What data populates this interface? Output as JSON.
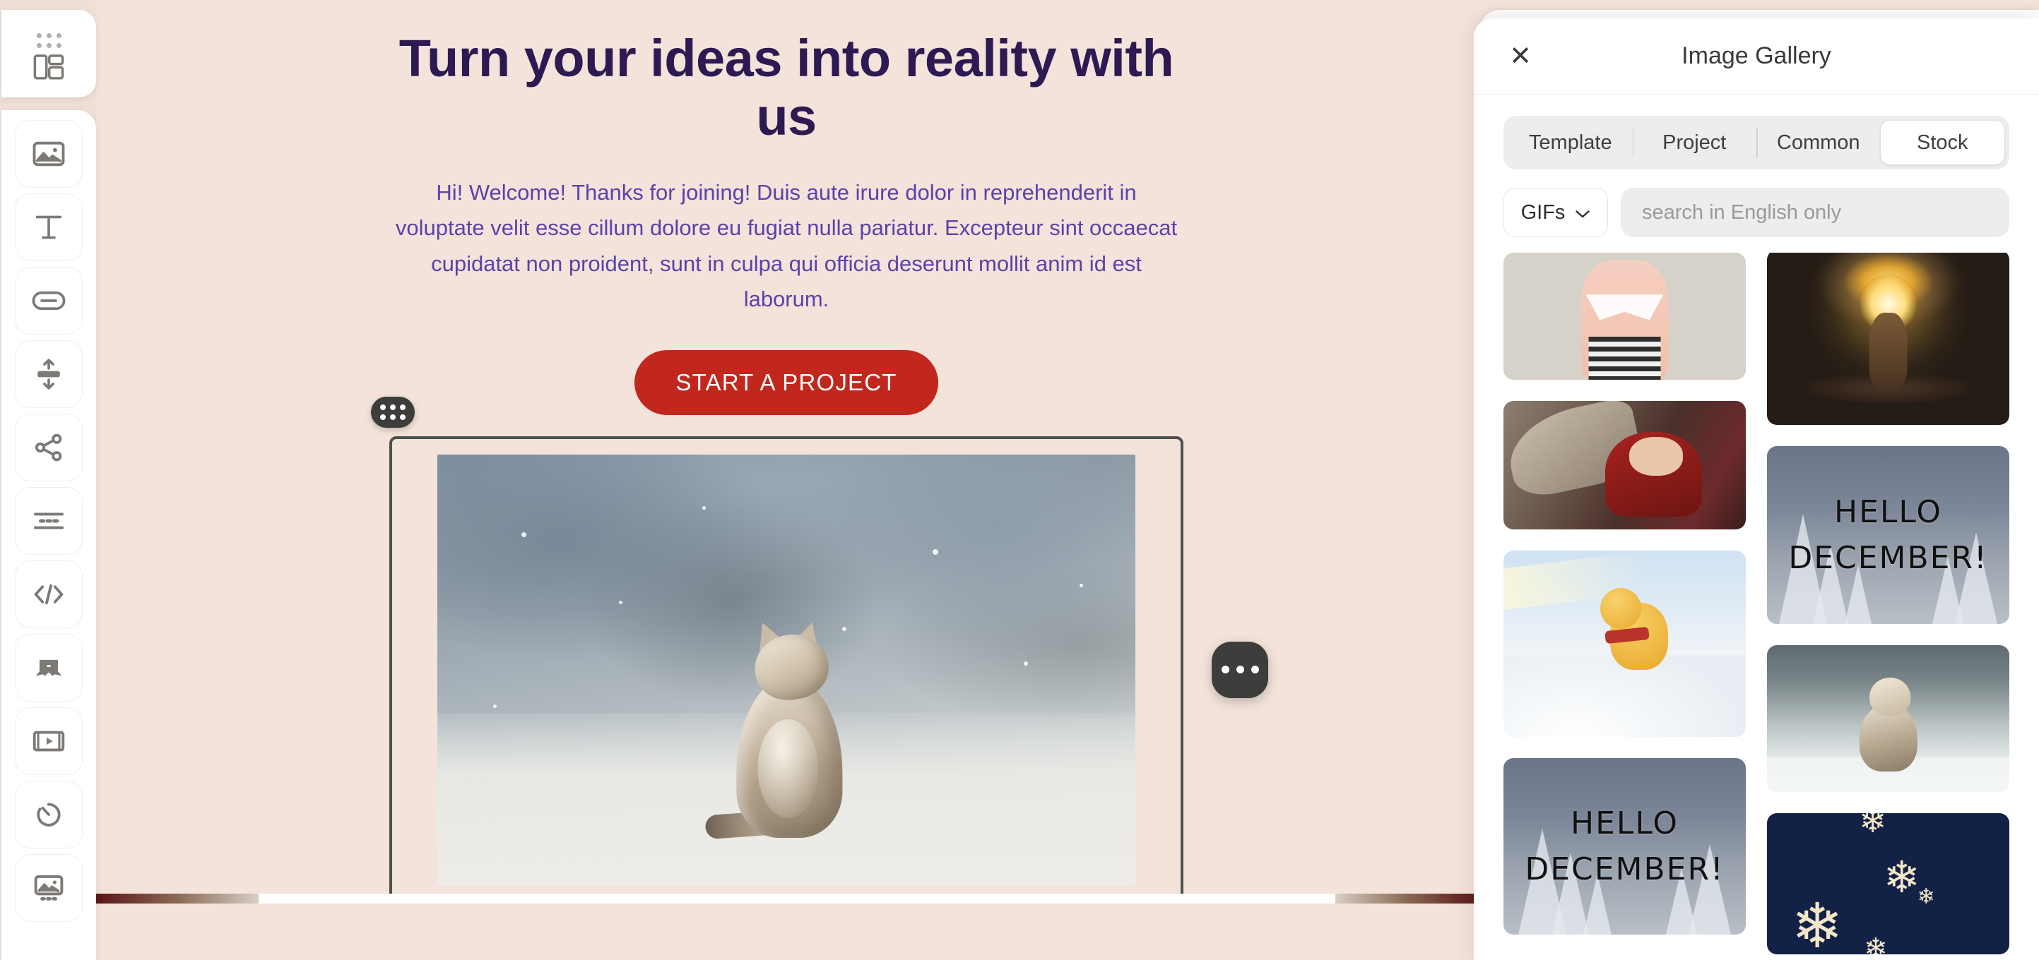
{
  "app": {
    "canvas_bg": "#f4e3da",
    "accent_cta": "#c1271d",
    "heading_color": "#2d1a52",
    "body_color": "#5b42a8"
  },
  "toolbar": {
    "logo_name": "layout-template-icon",
    "items": [
      {
        "name": "image-tool",
        "icon": "image-icon"
      },
      {
        "name": "text-tool",
        "icon": "text-t-icon"
      },
      {
        "name": "button-tool",
        "icon": "button-icon"
      },
      {
        "name": "spacer-tool",
        "icon": "spacer-arrows-icon"
      },
      {
        "name": "social-share-tool",
        "icon": "share-nodes-icon"
      },
      {
        "name": "divider-tool",
        "icon": "divider-icon"
      },
      {
        "name": "html-code-tool",
        "icon": "code-brackets-icon"
      },
      {
        "name": "banner-tool",
        "icon": "banner-ribbon-icon"
      },
      {
        "name": "video-tool",
        "icon": "video-play-icon"
      },
      {
        "name": "timer-tool",
        "icon": "countdown-timer-icon"
      },
      {
        "name": "image-carousel-tool",
        "icon": "image-carousel-icon"
      }
    ]
  },
  "content": {
    "heading": "Turn your ideas into reality with us",
    "body": "Hi! Welcome! Thanks for joining! Duis aute irure dolor in reprehenderit in voluptate velit esse cillum dolore eu fugiat nulla pariatur. Excepteur sint occaecat cupidatat non proident, sunt in culpa qui officia deserunt mollit anim id est laborum.",
    "cta_label": "START A PROJECT",
    "selected_block": {
      "type": "image",
      "alt": "Fluffy tabby kitten sitting in snow looking up",
      "drag_handle_name": "drag-handle",
      "more_options_name": "block-more-options"
    }
  },
  "gallery": {
    "title": "Image Gallery",
    "close_label": "✕",
    "tabs": [
      {
        "label": "Template",
        "active": false
      },
      {
        "label": "Project",
        "active": false
      },
      {
        "label": "Common",
        "active": false
      },
      {
        "label": "Stock",
        "active": true
      }
    ],
    "filter": {
      "label": "GIFs",
      "chevron": "⌄"
    },
    "search": {
      "value": "",
      "placeholder": "search in English only"
    },
    "items_left": [
      {
        "name": "gallery-item-mannequin",
        "caption": ""
      },
      {
        "name": "gallery-item-kid-scarf",
        "caption": ""
      },
      {
        "name": "gallery-item-pooh-snow",
        "caption": ""
      },
      {
        "name": "gallery-item-hello-december-a",
        "caption": "HELLO DECEMBER!"
      }
    ],
    "items_right": [
      {
        "name": "gallery-item-glowing-deer",
        "caption": ""
      },
      {
        "name": "gallery-item-hello-december-b",
        "caption": "HELLO DECEMBER!"
      },
      {
        "name": "gallery-item-kitten-snow",
        "caption": ""
      },
      {
        "name": "gallery-item-snowflakes",
        "caption": ""
      }
    ],
    "december_caption_line1": "HELLO",
    "december_caption_line2": "DECEMBER!"
  }
}
